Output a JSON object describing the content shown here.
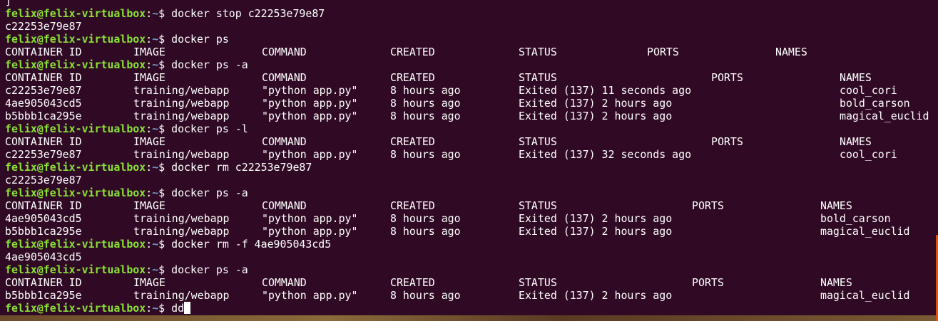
{
  "terminal": {
    "colors": {
      "background": "#300a24",
      "prompt_user": "#8ae234",
      "prompt_path": "#729fcf",
      "text": "#ffffff"
    },
    "prompt": {
      "user_host": "felix@felix-virtualbox",
      "colon": ":",
      "path": "~",
      "dollar": "$ "
    },
    "top_partial_line": "]",
    "commands": [
      "docker stop c22253e79e87",
      "docker ps",
      "docker ps -a",
      "docker ps -l",
      "docker rm c22253e79e87",
      "docker ps -a",
      "docker rm -f 4ae905043cd5",
      "docker ps -a",
      "dd"
    ],
    "outputs": {
      "stop_result": "c22253e79e87",
      "rm_result": "c22253e79e87",
      "rm_f_result": "4ae905043cd5"
    },
    "headers": {
      "container_id": "CONTAINER ID",
      "image": "IMAGE",
      "command": "COMMAND",
      "created": "CREATED",
      "status": "STATUS",
      "ports": "PORTS",
      "names": "NAMES"
    },
    "ps_a_1": [
      {
        "id": "c22253e79e87",
        "image": "training/webapp",
        "command": "\"python app.py\"",
        "created": "8 hours ago",
        "status": "Exited (137) 11 seconds ago",
        "names": "cool_cori"
      },
      {
        "id": "4ae905043cd5",
        "image": "training/webapp",
        "command": "\"python app.py\"",
        "created": "8 hours ago",
        "status": "Exited (137) 2 hours ago",
        "names": "bold_carson"
      },
      {
        "id": "b5bbb1ca295e",
        "image": "training/webapp",
        "command": "\"python app.py\"",
        "created": "8 hours ago",
        "status": "Exited (137) 2 hours ago",
        "names": "magical_euclid"
      }
    ],
    "ps_l": [
      {
        "id": "c22253e79e87",
        "image": "training/webapp",
        "command": "\"python app.py\"",
        "created": "8 hours ago",
        "status": "Exited (137) 32 seconds ago",
        "names": "cool_cori"
      }
    ],
    "ps_a_2": [
      {
        "id": "4ae905043cd5",
        "image": "training/webapp",
        "command": "\"python app.py\"",
        "created": "8 hours ago",
        "status": "Exited (137) 2 hours ago",
        "names": "bold_carson"
      },
      {
        "id": "b5bbb1ca295e",
        "image": "training/webapp",
        "command": "\"python app.py\"",
        "created": "8 hours ago",
        "status": "Exited (137) 2 hours ago",
        "names": "magical_euclid"
      }
    ],
    "ps_a_3": [
      {
        "id": "b5bbb1ca295e",
        "image": "training/webapp",
        "command": "\"python app.py\"",
        "created": "8 hours ago",
        "status": "Exited (137) 2 hours ago",
        "names": "magical_euclid"
      }
    ]
  }
}
